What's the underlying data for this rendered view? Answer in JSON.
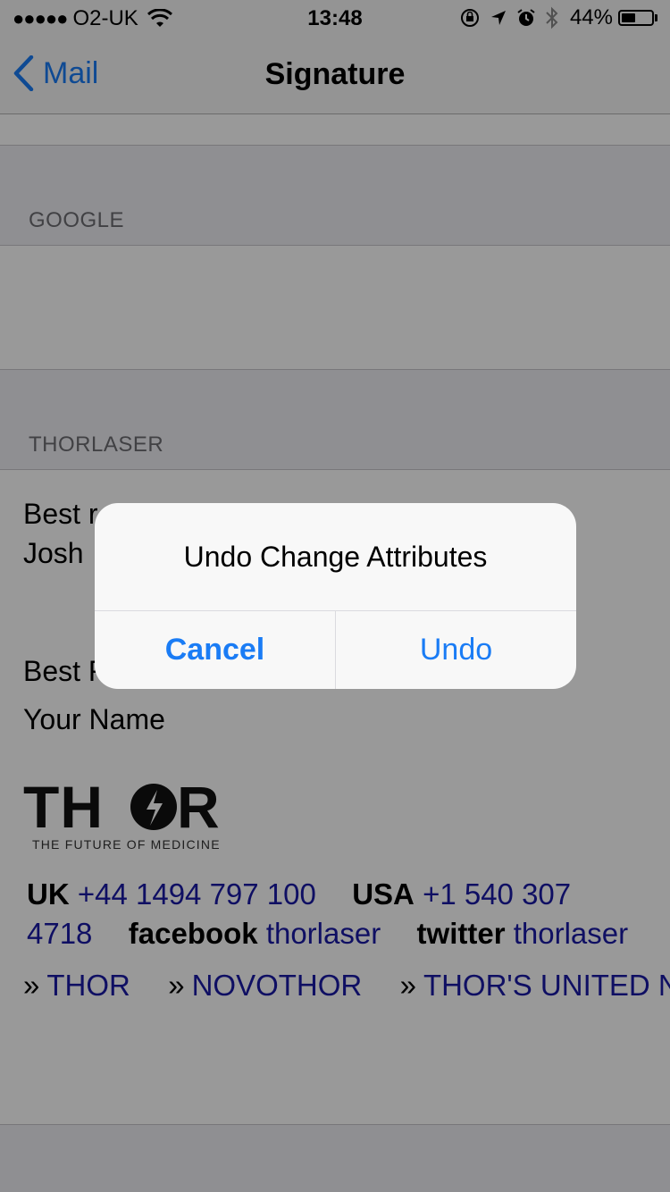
{
  "status_bar": {
    "carrier": "O2-UK",
    "time": "13:48",
    "battery_percent": "44%",
    "battery_level": 0.44
  },
  "nav": {
    "back_label": "Mail",
    "title": "Signature"
  },
  "sections": {
    "google_header": "GOOGLE",
    "thorlaser_header": "THORLASER"
  },
  "signature": {
    "line1": "Best r",
    "line2": "Josh",
    "line3": "Best R",
    "line4": "Your Name",
    "logo_text": "THOR",
    "logo_tagline": "THE FUTURE OF MEDICINE",
    "uk_label": "UK",
    "uk_phone": "+44 1494 797 100",
    "usa_label": "USA",
    "usa_phone_part1": "+1 540 307",
    "usa_phone_part2": "4718",
    "facebook_label": "facebook",
    "facebook_handle": "thorlaser",
    "twitter_label": "twitter",
    "twitter_handle": "thorlaser",
    "links": [
      "THOR",
      "NOVOTHOR",
      "THOR'S UNITED NA"
    ],
    "link_prefix": "»"
  },
  "alert": {
    "title": "Undo Change Attributes",
    "cancel_label": "Cancel",
    "undo_label": "Undo"
  },
  "colors": {
    "accent": "#1a7cf5",
    "link": "#1a1aa6",
    "dim_overlay": "rgba(0,0,0,0.4)"
  }
}
